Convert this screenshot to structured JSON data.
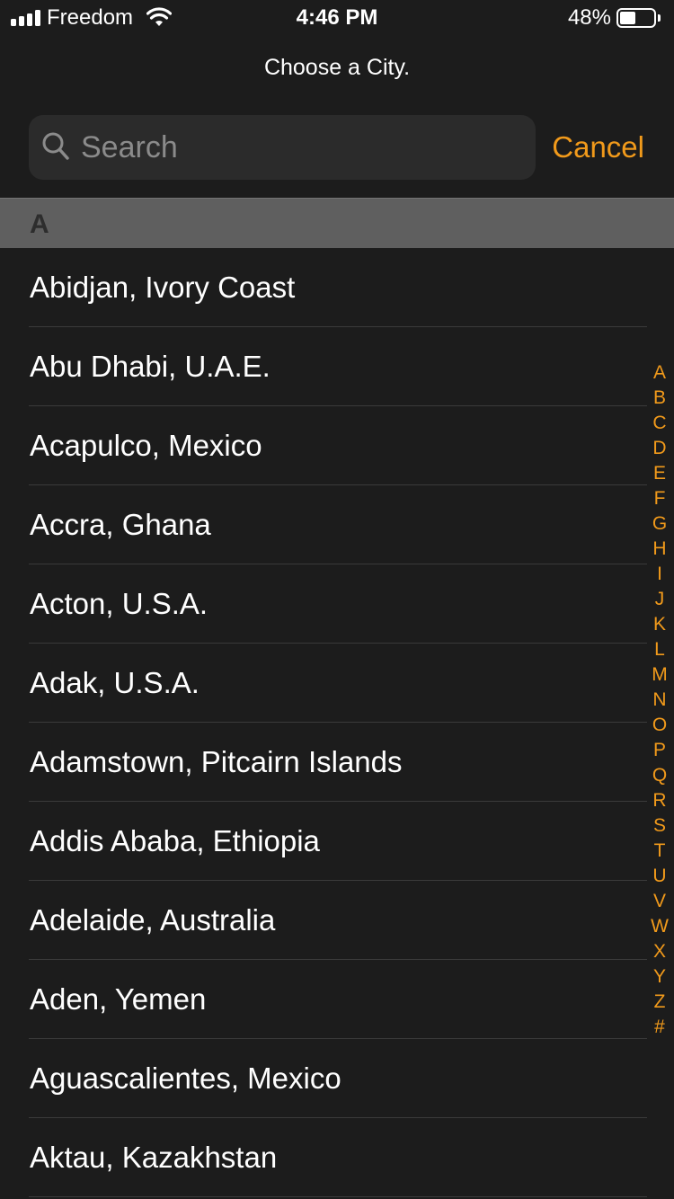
{
  "status_bar": {
    "carrier": "Freedom",
    "time": "4:46 PM",
    "battery_percent": "48%",
    "battery_level": 0.48,
    "signal_bars": 4,
    "wifi_icon": "wifi-icon"
  },
  "header": {
    "prompt": "Choose a City."
  },
  "search": {
    "placeholder": "Search",
    "value": "",
    "icon": "search-icon",
    "cancel_label": "Cancel"
  },
  "section": {
    "letter": "A"
  },
  "cities": [
    "Abidjan, Ivory Coast",
    "Abu Dhabi, U.A.E.",
    "Acapulco, Mexico",
    "Accra, Ghana",
    "Acton, U.S.A.",
    "Adak, U.S.A.",
    "Adamstown, Pitcairn Islands",
    "Addis Ababa, Ethiopia",
    "Adelaide, Australia",
    "Aden, Yemen",
    "Aguascalientes, Mexico",
    "Aktau, Kazakhstan"
  ],
  "index_letters": [
    "A",
    "B",
    "C",
    "D",
    "E",
    "F",
    "G",
    "H",
    "I",
    "J",
    "K",
    "L",
    "M",
    "N",
    "O",
    "P",
    "Q",
    "R",
    "S",
    "T",
    "U",
    "V",
    "W",
    "X",
    "Y",
    "Z",
    "#"
  ],
  "colors": {
    "background": "#1c1c1c",
    "accent": "#f19a1b",
    "section_header": "#5f5f5f",
    "search_field": "#2b2b2b",
    "text": "#ffffff"
  }
}
